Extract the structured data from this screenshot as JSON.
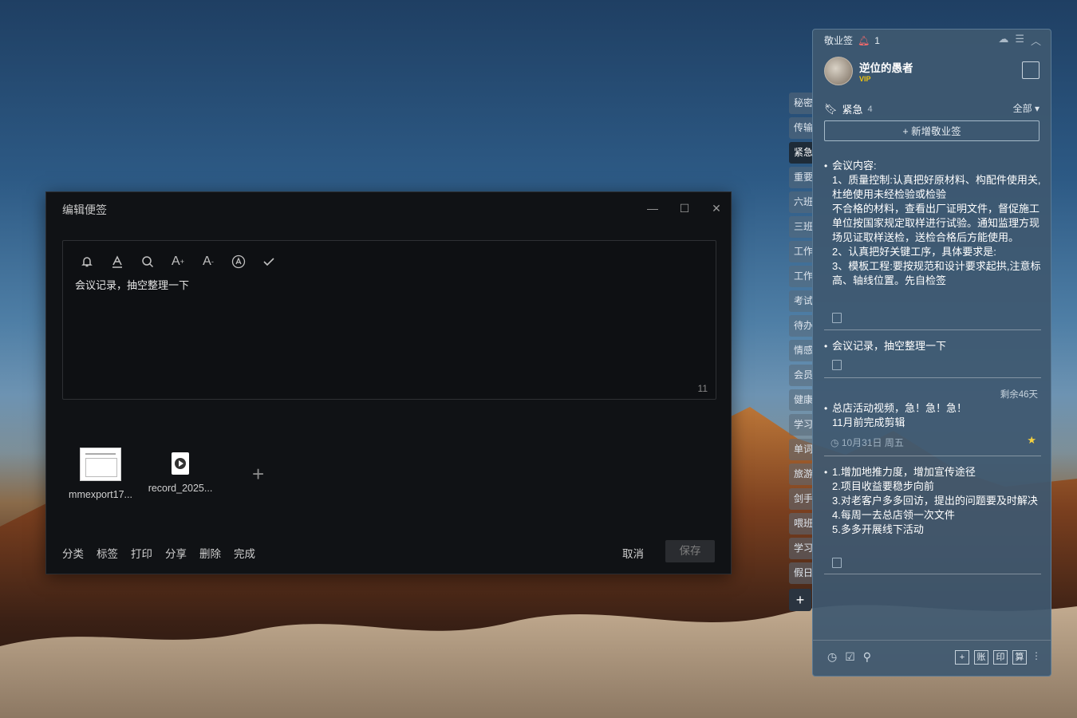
{
  "editor": {
    "title": "编辑便签",
    "content": "会议记录，抽空整理一下",
    "char_count": "11",
    "attachments": [
      {
        "name": "mmexport17..."
      },
      {
        "name": "record_2025..."
      }
    ],
    "footer_actions": [
      "分类",
      "标签",
      "打印",
      "分享",
      "删除",
      "完成"
    ],
    "cancel_label": "取消",
    "save_label": "保存",
    "toolbar_icons": [
      "bell-icon",
      "text-color-icon",
      "search-icon",
      "font-increase-icon",
      "font-decrease-icon",
      "font-style-icon",
      "check-icon"
    ]
  },
  "tabs": [
    "秘密",
    "传输",
    "紧急",
    "重要",
    "六班",
    "三班",
    "工作",
    "工作",
    "考试",
    "待办",
    "情感",
    "会员",
    "健康",
    "学习",
    "单词",
    "旅游",
    "剑手",
    "喂班",
    "学习",
    "假日"
  ],
  "panel": {
    "app_name": "敬业签",
    "notification_count": "1",
    "user": {
      "name": "逆位的愚者",
      "vip": "VIP"
    },
    "category": {
      "name": "紧急",
      "count": "4",
      "filter": "全部"
    },
    "new_button": "+ 新增敬业签",
    "notes": [
      {
        "text": "会议内容:\n1、质量控制:认真把好原材料、构配件使用关,杜绝使用未经检验或检验\n不合格的材料，查看出厂证明文件，督促施工单位按国家规定取样进行试验。通知监理方现场见证取样送检，送检合格后方能使用。\n2、认真把好关键工序，具体要求是:\n3、模板工程:要按规范和设计要求起拱,注意标高、轴线位置。先自检签"
      },
      {
        "text": "会议记录，抽空整理一下"
      },
      {
        "remaining": "剩余46天",
        "text": "总店活动视频，急！急！急！\n11月前完成剪辑",
        "date": "10月31日 周五"
      },
      {
        "text": "1.增加地推力度，增加宣传途径\n2.项目收益要稳步向前\n3.对老客户多多回访，提出的问题要及时解决\n4.每周一去总店领一次文件\n5.多多开展线下活动"
      }
    ],
    "bottom_right": [
      "+",
      "账",
      "印",
      "算"
    ]
  }
}
